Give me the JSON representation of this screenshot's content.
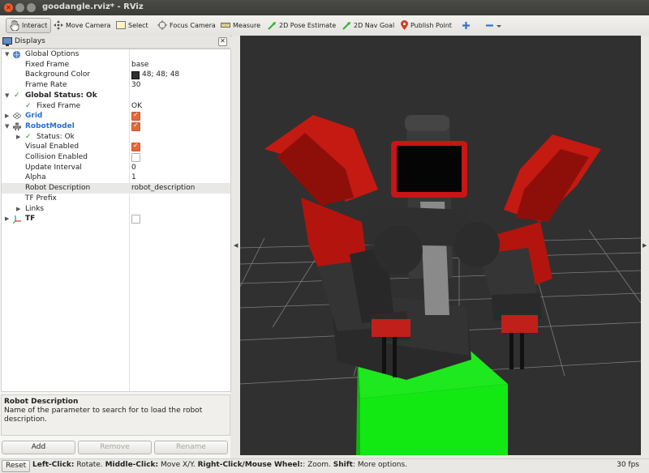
{
  "window": {
    "title": "goodangle.rviz* - RViz"
  },
  "toolbar": {
    "interact": "Interact",
    "move_camera": "Move Camera",
    "select": "Select",
    "focus_camera": "Focus Camera",
    "measure": "Measure",
    "pose_estimate": "2D Pose Estimate",
    "nav_goal": "2D Nav Goal",
    "publish_point": "Publish Point"
  },
  "displays": {
    "title": "Displays",
    "rows": {
      "global_options": "Global Options",
      "fixed_frame": "Fixed Frame",
      "fixed_frame_val": "base",
      "background_color": "Background Color",
      "background_color_val": "48; 48; 48",
      "frame_rate": "Frame Rate",
      "frame_rate_val": "30",
      "global_status": "Global Status: Ok",
      "fixed_frame_status": "Fixed Frame",
      "fixed_frame_status_val": "OK",
      "grid": "Grid",
      "robot_model": "RobotModel",
      "status": "Status: Ok",
      "visual_enabled": "Visual Enabled",
      "collision_enabled": "Collision Enabled",
      "update_interval": "Update Interval",
      "update_interval_val": "0",
      "alpha": "Alpha",
      "alpha_val": "1",
      "robot_description": "Robot Description",
      "robot_description_val": "robot_description",
      "tf_prefix": "TF Prefix",
      "links": "Links",
      "tf": "TF"
    }
  },
  "description": {
    "title": "Robot Description",
    "text": "Name of the parameter to search for to load the robot description."
  },
  "buttons": {
    "add": "Add",
    "remove": "Remove",
    "rename": "Rename"
  },
  "status": {
    "reset": "Reset",
    "lc": "Left-Click:",
    "lc_t": " Rotate. ",
    "mc": "Middle-Click:",
    "mc_t": " Move X/Y. ",
    "rc": "Right-Click/Mouse Wheel:",
    "rc_t": ": Zoom. ",
    "sh": "Shift",
    "sh_t": ": More options.",
    "fps": "30 fps"
  },
  "colors": {
    "bg": "#303030",
    "robot_red": "#c41a12",
    "block": "#11ee11",
    "accent": "#e3683a"
  }
}
